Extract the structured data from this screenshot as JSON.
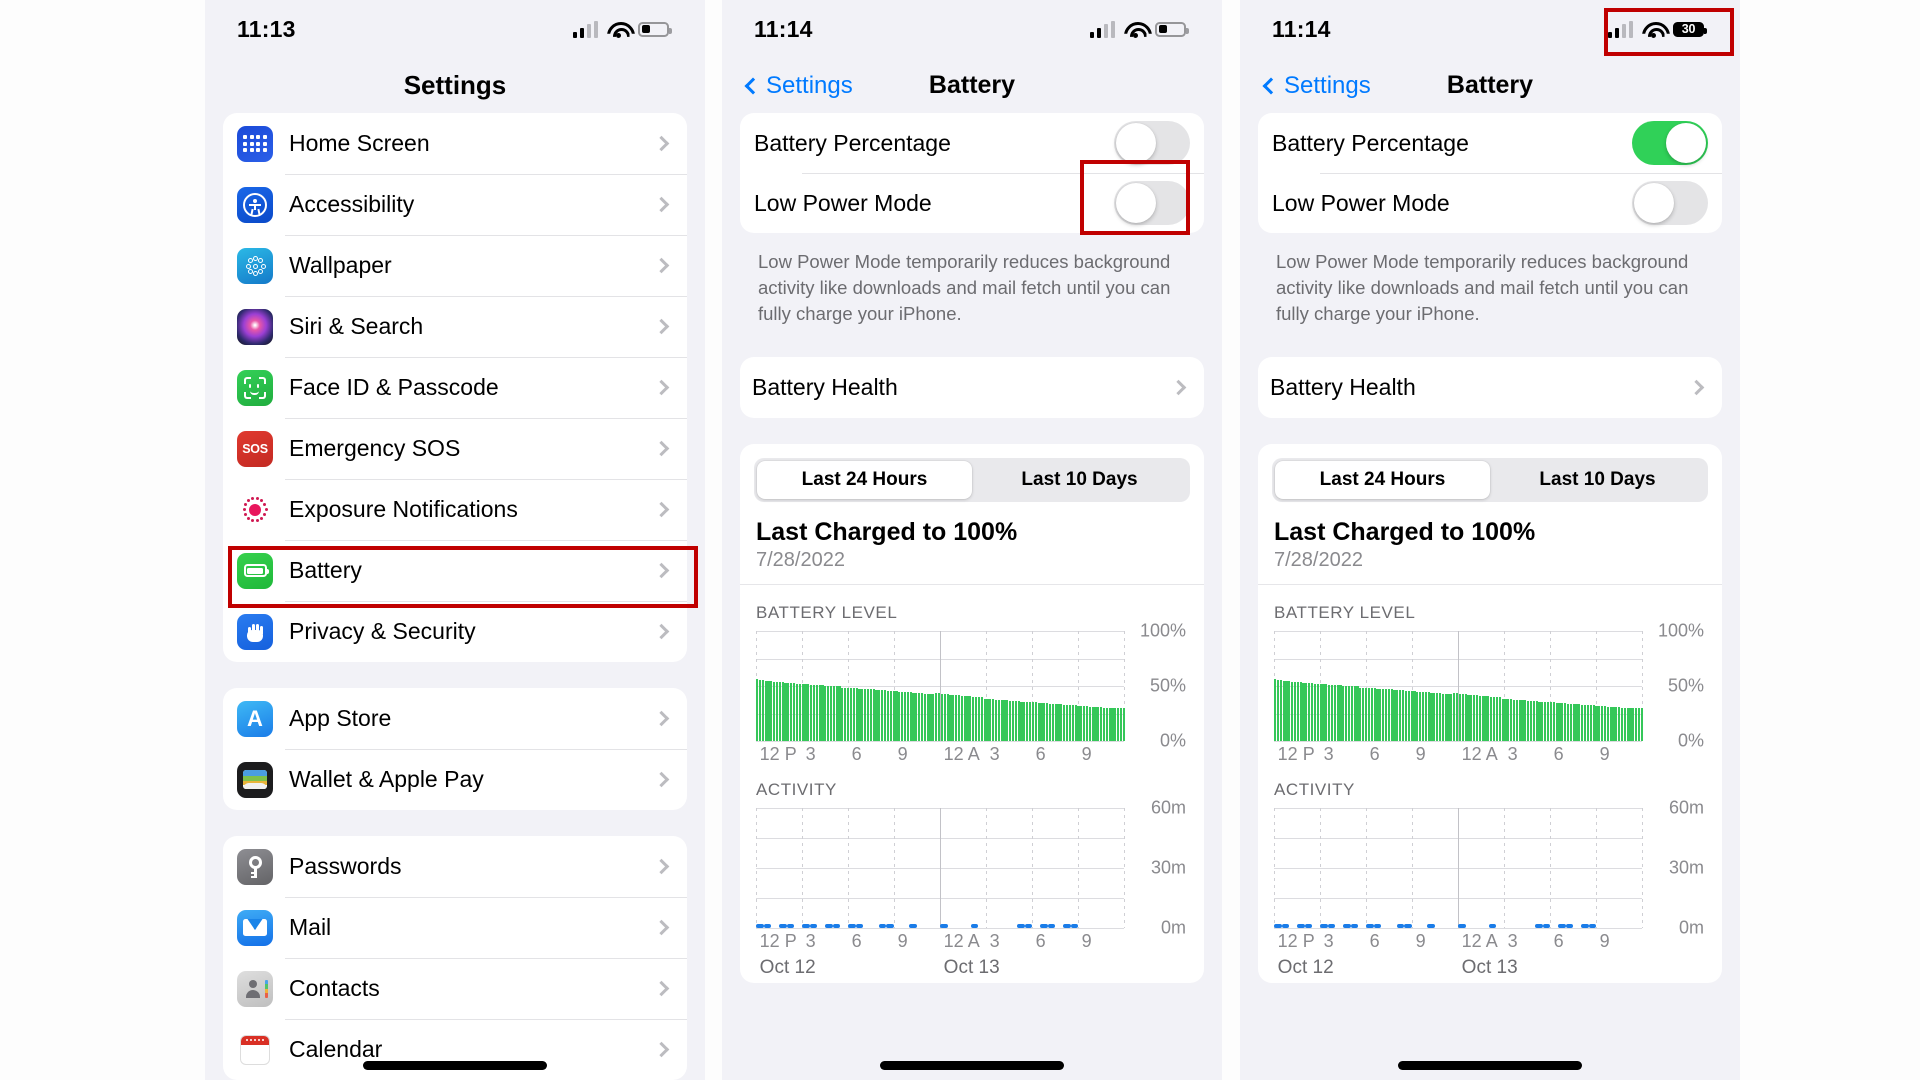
{
  "panels": {
    "settings": {
      "status": {
        "time": "11:13",
        "battery_level_pct": 30
      },
      "nav_title": "Settings",
      "groups": [
        {
          "items": [
            {
              "label": "Home Screen",
              "icon": "home-screen-icon"
            },
            {
              "label": "Accessibility",
              "icon": "accessibility-icon"
            },
            {
              "label": "Wallpaper",
              "icon": "wallpaper-icon"
            },
            {
              "label": "Siri & Search",
              "icon": "siri-icon"
            },
            {
              "label": "Face ID & Passcode",
              "icon": "face-id-icon"
            },
            {
              "label": "Emergency SOS",
              "icon": "sos-icon"
            },
            {
              "label": "Exposure Notifications",
              "icon": "exposure-notifications-icon"
            },
            {
              "label": "Battery",
              "icon": "battery-icon"
            },
            {
              "label": "Privacy & Security",
              "icon": "privacy-icon"
            }
          ]
        },
        {
          "items": [
            {
              "label": "App Store",
              "icon": "app-store-icon"
            },
            {
              "label": "Wallet & Apple Pay",
              "icon": "wallet-icon"
            }
          ]
        },
        {
          "items": [
            {
              "label": "Passwords",
              "icon": "passwords-icon"
            },
            {
              "label": "Mail",
              "icon": "mail-icon"
            },
            {
              "label": "Contacts",
              "icon": "contacts-icon"
            },
            {
              "label": "Calendar",
              "icon": "calendar-icon"
            }
          ]
        }
      ]
    },
    "battery_off": {
      "status": {
        "time": "11:14",
        "battery_level_pct": 30
      },
      "nav_back": "Settings",
      "nav_title": "Battery",
      "battery_percentage_label": "Battery Percentage",
      "battery_percentage_on": false,
      "low_power_label": "Low Power Mode",
      "low_power_on": false,
      "footnote": "Low Power Mode temporarily reduces background activity like downloads and mail fetch until you can fully charge your iPhone.",
      "battery_health_label": "Battery Health"
    },
    "battery_on": {
      "status": {
        "time": "11:14",
        "battery_badge": "30"
      },
      "nav_back": "Settings",
      "nav_title": "Battery",
      "battery_percentage_label": "Battery Percentage",
      "battery_percentage_on": true,
      "low_power_label": "Low Power Mode",
      "low_power_on": false,
      "footnote": "Low Power Mode temporarily reduces background activity like downloads and mail fetch until you can fully charge your iPhone.",
      "battery_health_label": "Battery Health"
    }
  },
  "usage": {
    "segments": [
      {
        "label": "Last 24 Hours",
        "active": true
      },
      {
        "label": "Last 10 Days",
        "active": false
      }
    ],
    "last_charged_title": "Last Charged to 100%",
    "last_charged_date": "7/28/2022",
    "battery_level_caption": "BATTERY LEVEL",
    "activity_caption": "ACTIVITY",
    "date_labels": [
      "Oct 12",
      "Oct 13"
    ]
  },
  "colors": {
    "accent_blue": "#007aff",
    "toggle_on_green": "#30d158",
    "bar_green": "#35c759",
    "activity_blue": "#1a7ce8",
    "highlight_red": "#c00000",
    "panel_bg": "#f2f2f7"
  },
  "highlights": [
    {
      "name": "battery-settings-row-highlight"
    },
    {
      "name": "battery-percentage-toggle-highlight"
    },
    {
      "name": "status-bar-battery-highlight"
    }
  ],
  "chart_data": [
    {
      "type": "bar",
      "title": "BATTERY LEVEL",
      "xlabel": "",
      "ylabel": "",
      "ylim": [
        0,
        100
      ],
      "yticks": [
        "0%",
        "50%",
        "100%"
      ],
      "xticks": [
        "12 P",
        "3",
        "6",
        "9",
        "12 A",
        "3",
        "6",
        "9"
      ],
      "grid": true,
      "series": [
        {
          "name": "Battery level %",
          "color": "#35c759",
          "values": [
            57,
            56,
            56,
            55,
            55,
            55,
            54,
            54,
            54,
            54,
            53,
            53,
            53,
            53,
            52,
            52,
            52,
            52,
            52,
            51,
            51,
            51,
            51,
            51,
            50,
            50,
            50,
            50,
            50,
            50,
            49,
            49,
            49,
            49,
            49,
            49,
            48,
            48,
            48,
            48,
            48,
            48,
            47,
            47,
            47,
            47,
            46,
            46,
            46,
            46,
            45,
            45,
            45,
            45,
            45,
            44,
            44,
            44,
            44,
            43,
            43,
            43,
            43,
            44,
            44,
            43,
            43,
            43,
            42,
            42,
            42,
            42,
            41,
            41,
            41,
            41,
            40,
            40,
            40,
            40,
            39,
            39,
            39,
            39,
            38,
            38,
            38,
            38,
            38,
            37,
            37,
            37,
            37,
            36,
            36,
            36,
            36,
            36,
            36,
            35,
            35,
            35,
            35,
            34,
            34,
            34,
            34,
            34,
            33,
            33,
            33,
            33,
            33,
            32,
            32,
            32,
            32,
            31,
            31,
            31,
            31,
            31,
            30,
            30,
            30,
            30,
            30,
            30,
            30,
            30
          ]
        }
      ]
    },
    {
      "type": "bar",
      "title": "ACTIVITY",
      "xlabel": "",
      "ylabel": "",
      "ylim": [
        0,
        60
      ],
      "yticks": [
        "0m",
        "30m",
        "60m"
      ],
      "xticks": [
        "12 P",
        "3",
        "6",
        "9",
        "12 A",
        "3",
        "6",
        "9"
      ],
      "grid": true,
      "series": [
        {
          "name": "Screen on activity (minutes)",
          "color": "#1a7ce8",
          "segments_present": [
            1,
            1,
            0,
            1,
            1,
            0,
            1,
            1,
            0,
            1,
            1,
            0,
            1,
            1,
            0,
            0,
            1,
            1,
            0,
            0,
            1,
            0,
            0,
            0,
            1,
            0,
            0,
            0,
            1,
            0,
            0,
            0,
            0,
            0,
            1,
            1,
            0,
            1,
            1,
            0,
            1,
            1,
            0,
            0,
            0,
            0,
            0,
            0
          ]
        }
      ]
    }
  ]
}
